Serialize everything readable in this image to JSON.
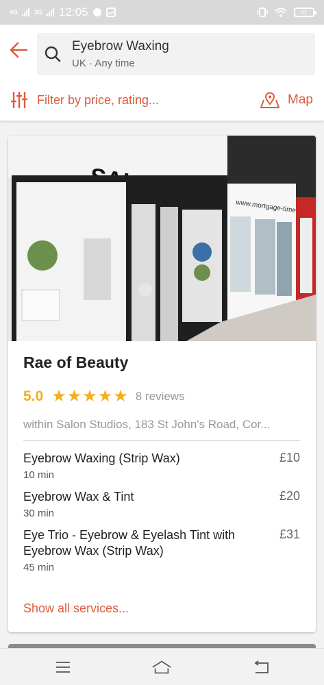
{
  "status_bar": {
    "network_1": "4G",
    "network_2": "3G",
    "time": "12:05",
    "battery": "61"
  },
  "search": {
    "query": "Eyebrow Waxing",
    "subtitle": "UK · Any time"
  },
  "toolbar": {
    "filter_label": "Filter by price, rating...",
    "map_label": "Map"
  },
  "venue": {
    "photo_sign": "SALON STUDIOS",
    "photo_neighbor_sign": "www.mortgage-time.co.uk",
    "name": "Rae of Beauty",
    "rating": "5.0",
    "stars": "★★★★★",
    "star_count": 5,
    "reviews": "8 reviews",
    "address": "within Salon Studios, 183 St John's Road, Cor...",
    "services": [
      {
        "name": "Eyebrow Waxing (Strip Wax)",
        "duration": "10 min",
        "price": "£10"
      },
      {
        "name": "Eyebrow Wax & Tint",
        "duration": "30 min",
        "price": "£20"
      },
      {
        "name": "Eye Trio - Eyebrow & Eyelash Tint with Eyebrow Wax (Strip Wax)",
        "duration": "45 min",
        "price": "£31"
      }
    ],
    "show_all": "Show all services..."
  },
  "colors": {
    "accent": "#e05a3a",
    "star": "#f2b01e"
  },
  "icons": {
    "back": "arrow-left-icon",
    "search": "search-icon",
    "filter": "sliders-icon",
    "map": "map-pin-icon",
    "menu": "menu-icon",
    "home": "home-icon",
    "recent": "back-nav-icon"
  }
}
